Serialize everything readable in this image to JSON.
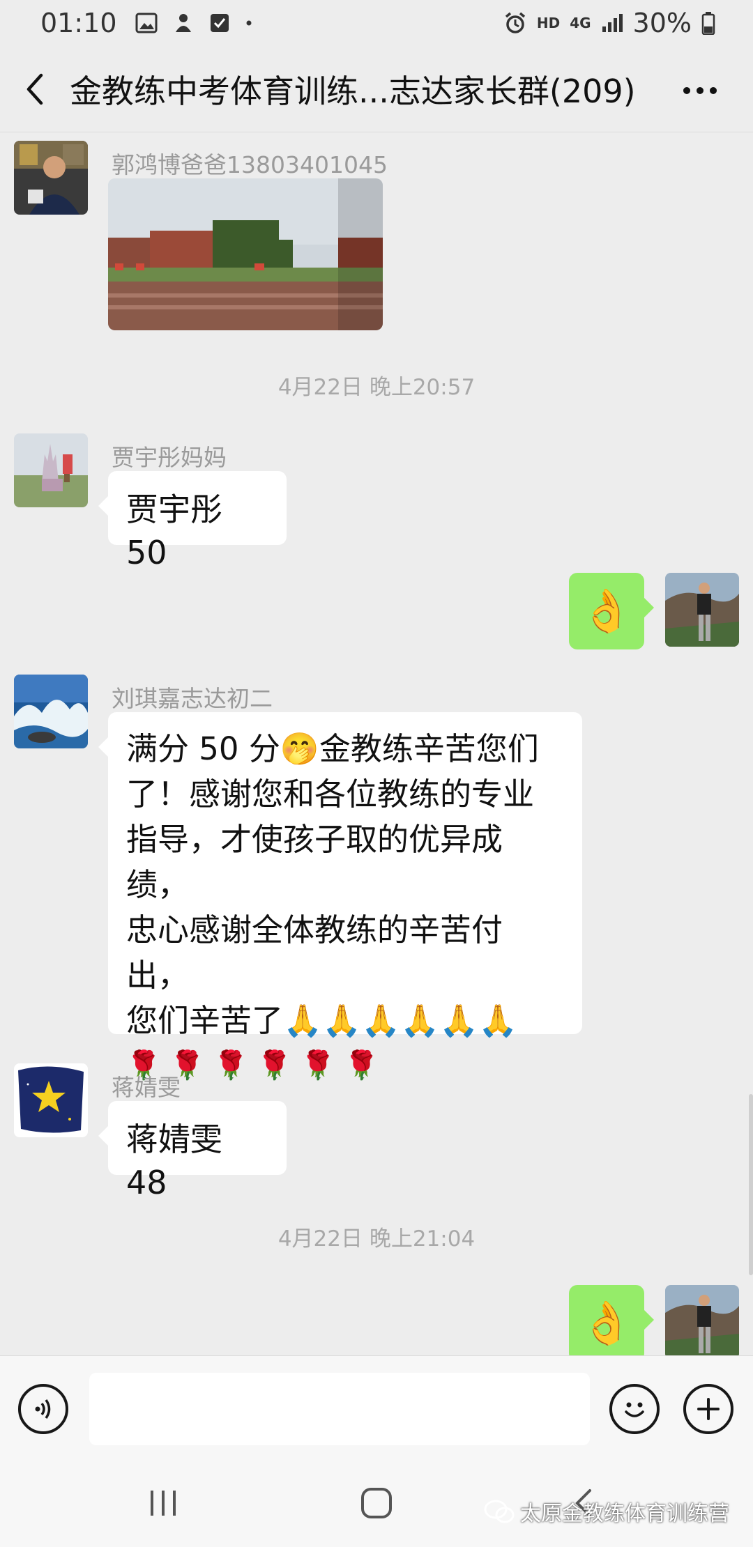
{
  "status_bar": {
    "time": "01:10",
    "hd": "HD",
    "net": "4G",
    "battery": "30%"
  },
  "header": {
    "title": "金教练中考体育训练...志达家长群(209)"
  },
  "messages": {
    "m1": {
      "sender": "郭鸿博爸爸13803401045"
    },
    "ts1": "4月22日 晚上20:57",
    "m2": {
      "sender": "贾宇彤妈妈",
      "text": "贾宇彤 50"
    },
    "m3": {
      "emoji": "👌"
    },
    "m4": {
      "sender": "刘琪嘉志达初二",
      "lines": [
        "满分 50 分🤭金教练辛苦您们",
        "了！感谢您和各位教练的专业",
        "指导，才使孩子取的优异成绩，",
        "忠心感谢全体教练的辛苦付出，",
        "您们辛苦了🙏🙏🙏🙏🙏🙏",
        "🌹 🌹 🌹 🌹 🌹 🌹"
      ]
    },
    "m5": {
      "sender": "蒋婧雯",
      "text": "蒋婧雯 48"
    },
    "ts2": "4月22日 晚上21:04",
    "m6": {
      "emoji": "👌"
    }
  },
  "watermark": "太原金教练体育训练营",
  "colors": {
    "bg": "#ededed",
    "bubble_self": "#95ec69",
    "bubble_other": "#ffffff"
  }
}
